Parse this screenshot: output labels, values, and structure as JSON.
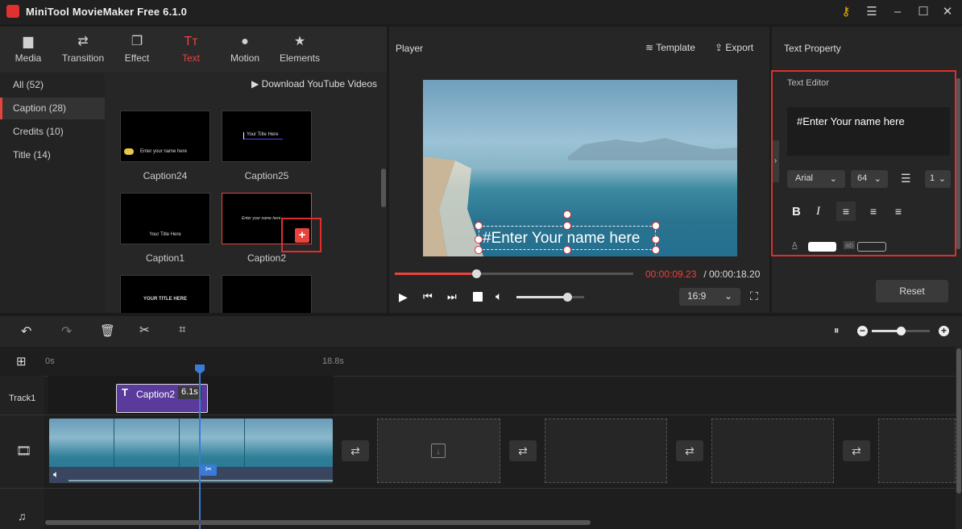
{
  "window": {
    "title": "MiniTool MovieMaker Free 6.1.0"
  },
  "nav": {
    "items": [
      {
        "label": "Media",
        "icon": "folder-icon"
      },
      {
        "label": "Transition",
        "icon": "transition-icon"
      },
      {
        "label": "Effect",
        "icon": "effect-icon"
      },
      {
        "label": "Text",
        "icon": "text-icon"
      },
      {
        "label": "Motion",
        "icon": "motion-icon"
      },
      {
        "label": "Elements",
        "icon": "elements-icon"
      }
    ],
    "active": "Text"
  },
  "categories": [
    {
      "label": "All (52)"
    },
    {
      "label": "Caption (28)"
    },
    {
      "label": "Credits (10)"
    },
    {
      "label": "Title (14)"
    }
  ],
  "library": {
    "download_label": "Download YouTube Videos",
    "thumbs": [
      {
        "caption": "Caption24",
        "inner": "Enter your name here"
      },
      {
        "caption": "Caption25",
        "inner": "Your Title Here"
      },
      {
        "caption": "Caption1",
        "inner": "Your Title Here"
      },
      {
        "caption": "Caption2",
        "inner": "Enter your name here"
      },
      {
        "caption": "",
        "inner": "YOUR TITLE HERE"
      },
      {
        "caption": "",
        "inner": ""
      }
    ]
  },
  "player": {
    "title": "Player",
    "template_label": "Template",
    "export_label": "Export",
    "overlay_text": "#Enter Your name here",
    "current_time": "00:00:09.23",
    "total_time": " / 00:00:18.20",
    "progress": 0.34,
    "volume": 0.75,
    "aspect": "16:9"
  },
  "text_property": {
    "title": "Text Property",
    "editor_label": "Text Editor",
    "text_value": "#Enter Your name here",
    "font": "Arial",
    "size": "64",
    "line_spacing": "1",
    "reset_label": "Reset",
    "colors": {
      "accent": "#e8443e",
      "highlight_box": "#e02e2e"
    }
  },
  "timeline": {
    "time_start": "0s",
    "time_mark": "18.8s",
    "track_label": "Track1",
    "clip_label": "Caption2",
    "clip_duration": "6.1s",
    "zoom": 0.5
  }
}
